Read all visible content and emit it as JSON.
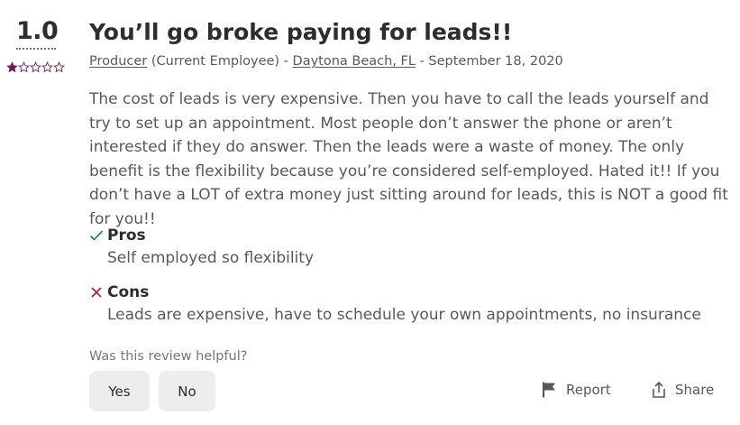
{
  "review": {
    "rating_value": "1.0",
    "rating_stars": 1,
    "rating_max": 5,
    "title": "You’ll go broke paying for leads!!",
    "job_title": "Producer",
    "employee_status": " (Current Employee) - ",
    "location": "Daytona Beach, FL",
    "date": " - September 18, 2020",
    "text": "The cost of leads is very expensive. Then you have to call the leads yourself and try to set up an appointment. Most people don’t answer the phone or aren’t interested if they do answer. Then the leads were a waste of money. The only benefit is the flexibility because you’re considered self-employed. Hated it!! If you don’t have a LOT of extra money just sitting around for leads, this is NOT a good fit for you!!",
    "pros_label": "Pros",
    "pros_text": "Self employed so flexibility",
    "cons_label": "Cons",
    "cons_text": "Leads are expensive, have to schedule your own appointments, no insurance"
  },
  "helpful": {
    "question": "Was this review helpful?",
    "yes_label": "Yes",
    "no_label": "No"
  },
  "actions": {
    "report_label": "Report",
    "share_label": "Share"
  },
  "colors": {
    "star_filled": "#6f1e51",
    "pros_check": "#1d7a2f",
    "cons_x": "#a8221f"
  }
}
